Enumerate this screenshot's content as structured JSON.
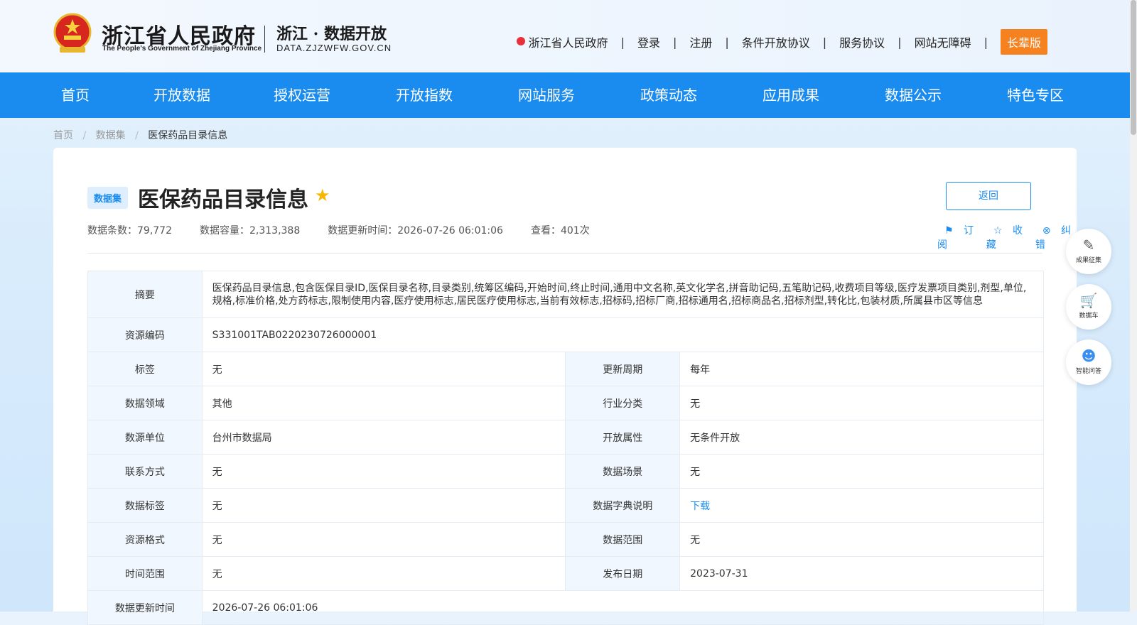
{
  "header": {
    "logo_cn": "浙江省人民政府",
    "logo_en": "The People's Government of Zhejiang Province",
    "site_cn": "浙江 · 数据开放",
    "site_en": "DATA.ZJZWFW.GOV.CN",
    "links": [
      "浙江省人民政府",
      "登录",
      "注册",
      "条件开放协议",
      "服务协议",
      "网站无障碍"
    ],
    "separator": "|",
    "elder_btn": "长辈版"
  },
  "nav": [
    "首页",
    "开放数据",
    "授权运营",
    "开放指数",
    "网站服务",
    "政策动态",
    "应用成果",
    "数据公示",
    "特色专区"
  ],
  "breadcrumb": [
    "首页",
    "数据集",
    "医保药品目录信息"
  ],
  "breadcrumb_sep": "/",
  "detail": {
    "badge": "数据集",
    "title": "医保药品目录信息",
    "star_icon": "★",
    "back_btn": "返回",
    "stats": [
      "数据条数：79,772",
      "数据容量：2,313,388",
      "数据更新时间：2026-07-26 06:01:06",
      "查看：401次"
    ],
    "actions": [
      "订阅",
      "收藏",
      "纠错"
    ],
    "action_icons": [
      "bookmark-icon",
      "star-outline-icon",
      "error-circle-icon"
    ]
  },
  "table": {
    "summary_label": "摘要",
    "summary": "医保药品目录信息,包含医保目录ID,医保目录名称,目录类别,统筹区编码,开始时间,终止时间,通用中文名称,英文化学名,拼音助记码,五笔助记码,收费项目等级,医疗发票项目类别,剂型,单位,规格,标准价格,处方药标志,限制使用内容,医疗使用标志,居民医疗使用标志,当前有效标志,招标码,招标厂商,招标通用名,招标商品名,招标剂型,转化比,包装材质,所属县市区等信息",
    "code_label": "资源编码",
    "code": "S331001TAB0220230726000001",
    "rows": [
      [
        "标签",
        "无",
        "更新周期",
        "每年"
      ],
      [
        "数据领域",
        "其他",
        "行业分类",
        "无"
      ],
      [
        "数源单位",
        "台州市数据局",
        "开放属性",
        "无条件开放"
      ],
      [
        "联系方式",
        "无",
        "数据场景",
        "无"
      ],
      [
        "数据标签",
        "无",
        "数据字典说明",
        "下载"
      ],
      [
        "资源格式",
        "无",
        "数据范围",
        "无"
      ],
      [
        "时间范围",
        "无",
        "发布日期",
        "2023-07-31"
      ]
    ],
    "last_label": "数据更新时间",
    "last_value": "2026-07-26 06:01:06"
  },
  "side_buttons": [
    "成果征集",
    "数据车",
    "智能问答"
  ],
  "side_icons": [
    "document-edit-icon",
    "cart-icon",
    "robot-icon"
  ],
  "colors": {
    "nav": "#1a8cf0",
    "elder": "#f5821f",
    "star": "#f5b800"
  }
}
